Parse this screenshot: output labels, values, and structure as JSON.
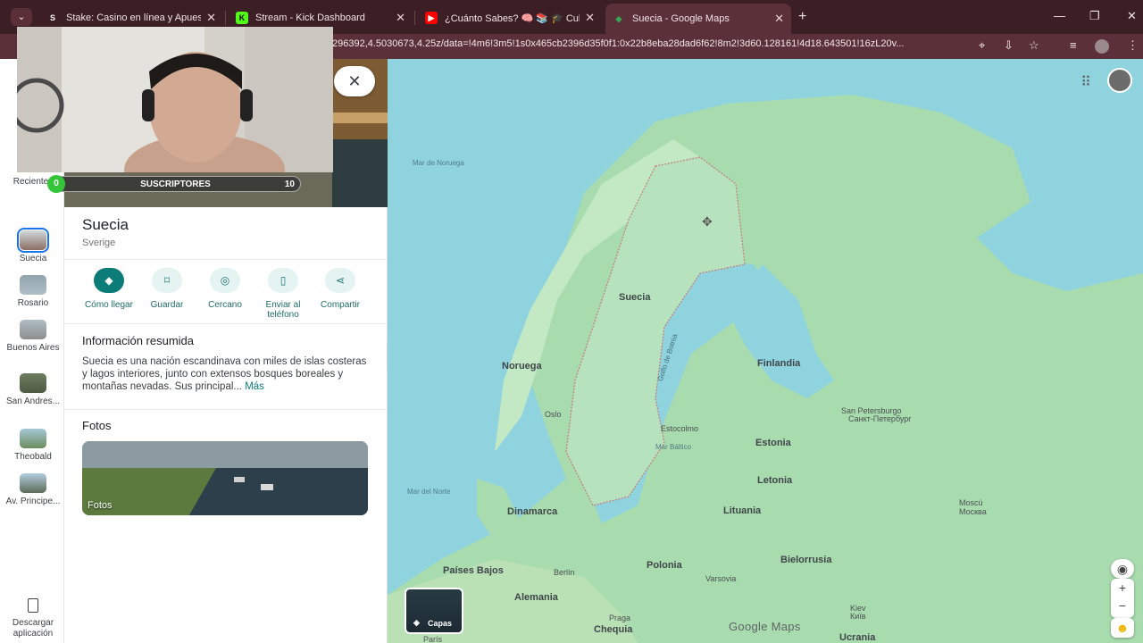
{
  "browser": {
    "tabs": [
      {
        "title": "Stake: Casino en línea y Apuestas",
        "favicon": "S",
        "favicon_color": "#ffffff",
        "favicon_bg": "#3c1f25"
      },
      {
        "title": "Stream - Kick Dashboard",
        "favicon": "K",
        "favicon_color": "#0b0b0b",
        "favicon_bg": "#53fc18"
      },
      {
        "title": "¿Cuánto Sabes? 🧠 📚 🎓 Cultura",
        "favicon": "▶",
        "favicon_color": "#ffffff",
        "favicon_bg": "#ff0000"
      },
      {
        "title": "Suecia - Google Maps",
        "favicon": "◆",
        "favicon_color": "#34a853",
        "favicon_bg": "#5b3038"
      }
    ],
    "new_tab": "+",
    "url": "296392,4.5030673,4.25z/data=!4m6!3m5!1s0x465cb2396d35f0f1:0x22b8eba28dad6f62!8m2!3d60.128161!4d18.643501!16zL20v...",
    "window_controls": [
      "—",
      "❐",
      "✕"
    ]
  },
  "stream": {
    "subscribers_label": "SUSCRIPTORES",
    "subscribers_left": "0",
    "subscribers_count": "10"
  },
  "rail": {
    "items": [
      {
        "label": "Recientes",
        "selected": false
      },
      {
        "label": "Suecia",
        "selected": true
      },
      {
        "label": "Rosario",
        "selected": false
      },
      {
        "label": "Buenos Aires",
        "selected": false
      },
      {
        "label": "San Andres...",
        "selected": false
      },
      {
        "label": "Theobald",
        "selected": false
      },
      {
        "label": "Av. Principe...",
        "selected": false
      }
    ],
    "download_label": "Descargar aplicación"
  },
  "place": {
    "title": "Suecia",
    "subtitle": "Sverige",
    "close": "✕",
    "actions": [
      {
        "label": "Cómo llegar",
        "icon": "◆"
      },
      {
        "label": "Guardar",
        "icon": "⌑"
      },
      {
        "label": "Cercano",
        "icon": "◎"
      },
      {
        "label": "Enviar al teléfono",
        "icon": "▯"
      },
      {
        "label": "Compartir",
        "icon": "⋖"
      }
    ],
    "summary_title": "Información resumida",
    "summary_text": "Suecia es una nación escandinava con miles de islas costeras y lagos interiores, junto con extensos bosques boreales y montañas nevadas. Sus principal...",
    "summary_more": "Más",
    "photos_title": "Fotos",
    "photos_label": "Fotos"
  },
  "map": {
    "labels": {
      "mar_noruega": "Mar de Noruega",
      "suecia": "Suecia",
      "noruega": "Noruega",
      "finlandia": "Finlandia",
      "golfo": "Golfo de Botnia",
      "oslo": "Oslo",
      "estocolmo": "Estocolmo",
      "mar_baltico": "Mar Báltico",
      "san_petersburgo": "San Petersburgo",
      "san_petersburgo_ru": "Санкт-Петербург",
      "estonia": "Estonia",
      "letonia": "Letonia",
      "lituania": "Lituania",
      "dinamarca": "Dinamarca",
      "mar_norte": "Mar del Norte",
      "paises_bajos": "Países Bajos",
      "berlin": "Berlín",
      "polonia": "Polonia",
      "bielorrusia": "Bielorrusia",
      "varsovia": "Varsovia",
      "moscu": "Moscú",
      "moscu_ru": "Москва",
      "alemania": "Alemania",
      "praga": "Praga",
      "chequia": "Chequia",
      "paris": "París",
      "kiev": "Kiev",
      "kiev_ua": "Київ",
      "ucrania": "Ucrania"
    },
    "layers_label": "Capas",
    "branding": "Google Maps",
    "zoom_in": "+",
    "zoom_out": "−"
  }
}
